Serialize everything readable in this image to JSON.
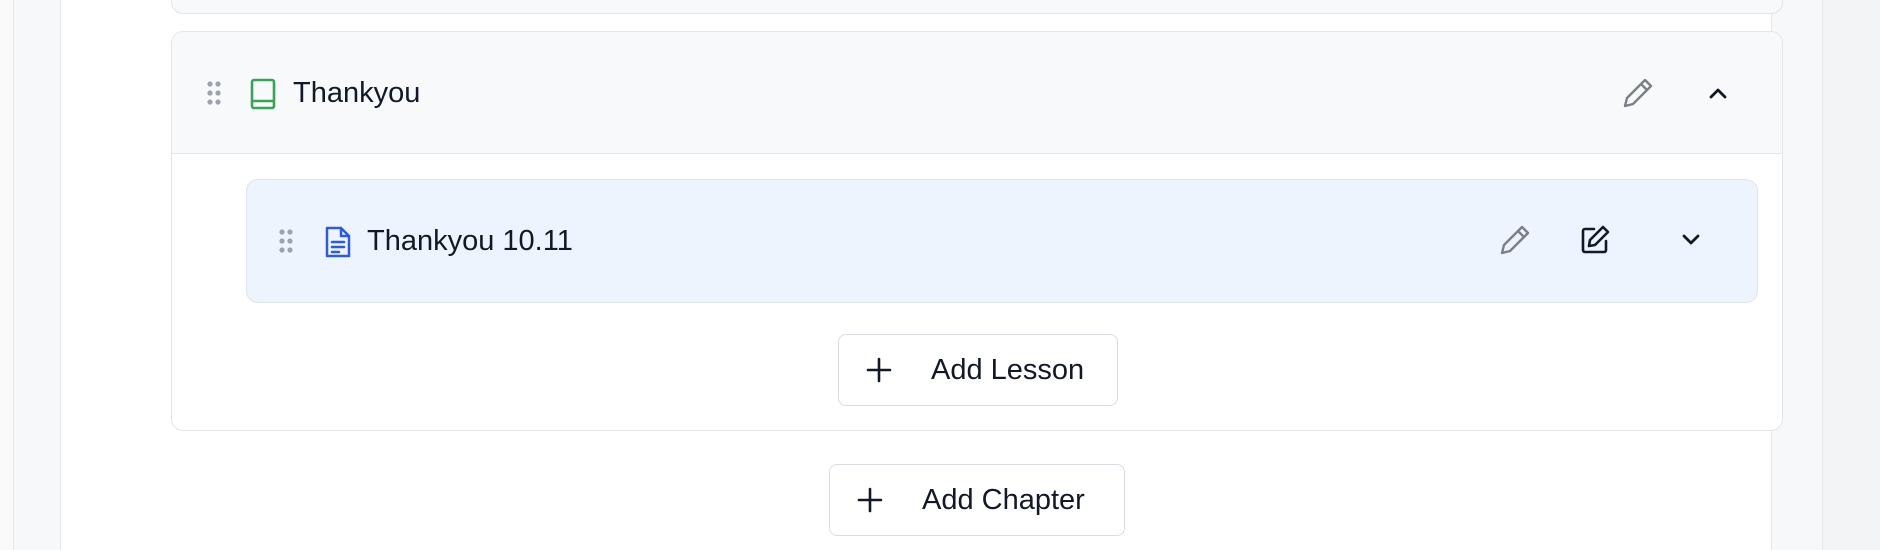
{
  "chapter": {
    "title": "Thankyou",
    "icons": {
      "drag": "drag-handle-icon",
      "type": "book-icon",
      "edit": "pencil-icon",
      "collapse": "chevron-up-icon"
    }
  },
  "lessons": [
    {
      "title": "Thankyou 10.11",
      "icons": {
        "drag": "drag-handle-icon",
        "type": "document-icon",
        "rename": "pencil-icon",
        "open_editor": "edit-square-icon",
        "expand": "chevron-down-icon"
      }
    }
  ],
  "actions": {
    "add_lesson_label": "Add Lesson",
    "add_chapter_label": "Add Chapter"
  },
  "colors": {
    "chapter_icon": "#3aa35a",
    "lesson_icon": "#2f5bd3",
    "lesson_row_bg": "#eef4fd",
    "chapter_header_bg": "#f8f9fb"
  }
}
